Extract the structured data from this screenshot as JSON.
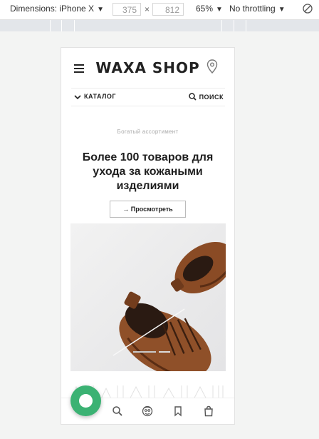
{
  "devtools": {
    "dimensions_label": "Dimensions: iPhone X",
    "width_value": "375",
    "times": "×",
    "height_value": "812",
    "zoom": "65%",
    "throttling": "No throttling"
  },
  "site": {
    "logo": "WAXA SHOP",
    "catalog_label": "КАТАЛОГ",
    "search_label": "ПОИСК",
    "eyebrow": "Богатый ассортимент",
    "headline": "Более 100 товаров для ухода за кожаными изделиями",
    "cta_label": "→ Просмотреть",
    "accent_color": "#3bb273"
  },
  "icons": {
    "menu": "hamburger-icon",
    "location": "map-pin-icon",
    "catalog": "chevron-down-icon",
    "search": "search-icon",
    "tabs": [
      "home-icon",
      "search-icon",
      "account-icon",
      "bookmark-icon",
      "bag-icon"
    ],
    "chat": "chat-icon",
    "rotate": "rotate-icon"
  }
}
